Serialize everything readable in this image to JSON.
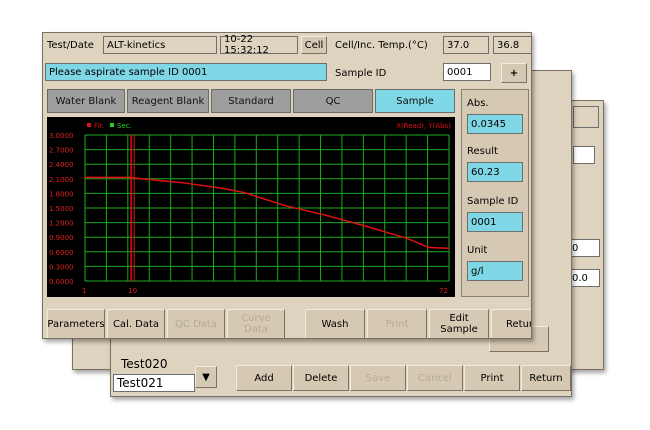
{
  "back_window2": {
    "row_values": [
      "0",
      "0.0"
    ]
  },
  "back_window1": {
    "list_items": [
      "Test020",
      "Test021"
    ],
    "buttons": [
      "Add",
      "Delete",
      "Save",
      "Cancel",
      "Print",
      "Return"
    ]
  },
  "main": {
    "test_label": "Test/Date",
    "test_name": "ALT-kinetics",
    "datetime": "10-22 15:32:12",
    "cell_button": "Cell",
    "temp_label": "Cell/Inc. Temp.(°C)",
    "temp1": "37.0",
    "temp2": "36.8",
    "message": "Please aspirate sample ID 0001",
    "sampleid_label": "Sample ID",
    "sampleid_value": "0001",
    "plus_button": "+",
    "tabs": [
      "Water Blank",
      "Reagent Blank",
      "Standard",
      "QC",
      "Sample"
    ],
    "active_tab": "Sample",
    "side": {
      "abs_label": "Abs.",
      "abs_value": "0.0345",
      "result_label": "Result",
      "result_value": "60.23",
      "sid_label": "Sample ID",
      "sid_value": "0001",
      "unit_label": "Unit",
      "unit_value": "g/l"
    },
    "bottom_buttons": [
      "Parameters",
      "Cal. Data",
      "QC Data",
      "Curve Data",
      "Wash",
      "Print",
      "Edit\nSample",
      "Return"
    ]
  },
  "chart_data": {
    "type": "line",
    "legend": [
      "Fir.",
      "Sec."
    ],
    "axis_title": "X(Read), Y(Abs)",
    "y_ticks": [
      "3.0000",
      "2.7000",
      "2.4000",
      "2.1000",
      "1.8000",
      "1.5000",
      "1.2000",
      "0.9000",
      "0.6000",
      "0.3000",
      "0.0000"
    ],
    "ylim": [
      0,
      3.0
    ],
    "x_ticks": [
      "1",
      "10",
      "72"
    ],
    "xlim": [
      1,
      72
    ],
    "marker_x": 10,
    "series": [
      {
        "name": "Sec.",
        "color": "#e01010",
        "x": [
          1,
          10,
          12,
          20,
          28,
          32,
          40,
          48,
          56,
          64,
          68,
          72
        ],
        "y": [
          2.13,
          2.13,
          2.1,
          2.02,
          1.9,
          1.82,
          1.55,
          1.35,
          1.12,
          0.87,
          0.69,
          0.67
        ]
      }
    ],
    "colors": {
      "background": "#000000",
      "grid": "#1faa1f",
      "axis_text": "#e02020"
    }
  }
}
